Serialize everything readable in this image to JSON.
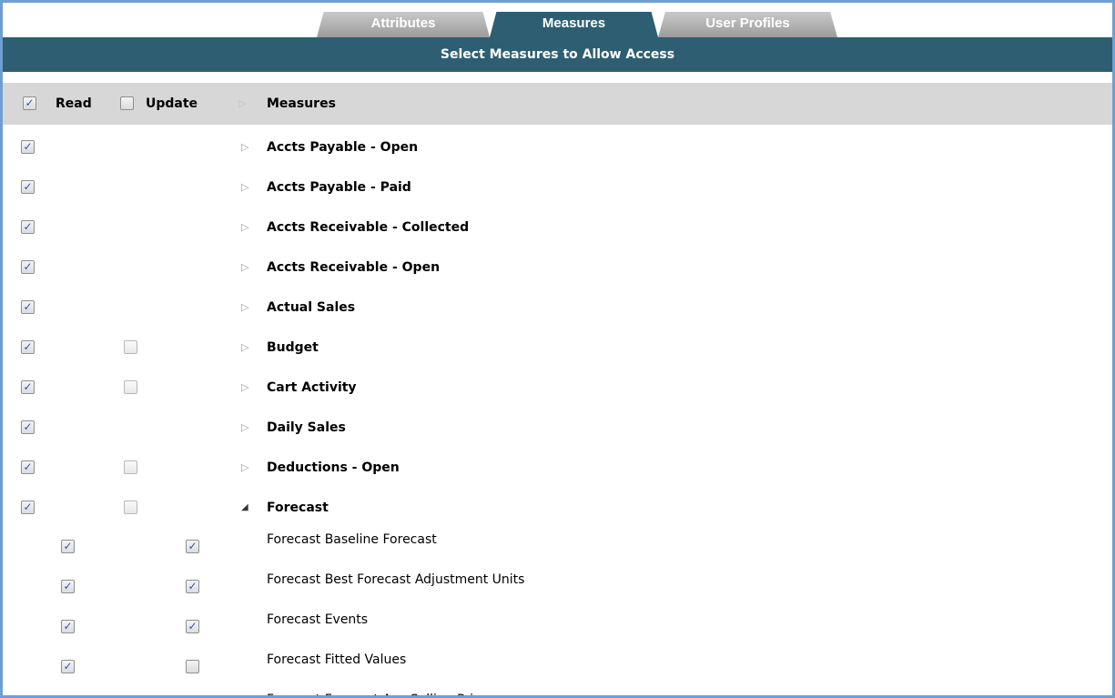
{
  "tabs": [
    {
      "label": "Attributes",
      "active": false
    },
    {
      "label": "Measures",
      "active": true
    },
    {
      "label": "User Profiles",
      "active": false
    }
  ],
  "title": "Select Measures to Allow Access",
  "header": {
    "read_label": "Read",
    "update_label": "Update",
    "measures_label": "Measures",
    "read_all_checked": true,
    "update_all_checked": false
  },
  "measures": [
    {
      "label": "Accts Payable - Open",
      "read": true,
      "update": null,
      "expanded": false
    },
    {
      "label": "Accts Payable - Paid",
      "read": true,
      "update": null,
      "expanded": false
    },
    {
      "label": "Accts Receivable - Collected",
      "read": true,
      "update": null,
      "expanded": false
    },
    {
      "label": "Accts Receivable - Open",
      "read": true,
      "update": null,
      "expanded": false
    },
    {
      "label": "Actual Sales",
      "read": true,
      "update": null,
      "expanded": false
    },
    {
      "label": "Budget",
      "read": true,
      "update": false,
      "expanded": false
    },
    {
      "label": "Cart Activity",
      "read": true,
      "update": false,
      "expanded": false
    },
    {
      "label": "Daily Sales",
      "read": true,
      "update": null,
      "expanded": false
    },
    {
      "label": "Deductions - Open",
      "read": true,
      "update": false,
      "expanded": false
    },
    {
      "label": "Forecast",
      "read": true,
      "update": false,
      "expanded": true
    }
  ],
  "forecast_children": [
    {
      "label": "Forecast Baseline Forecast",
      "read": true,
      "update": true
    },
    {
      "label": "Forecast Best Forecast Adjustment Units",
      "read": true,
      "update": true
    },
    {
      "label": "Forecast Events",
      "read": true,
      "update": true
    },
    {
      "label": "Forecast Fitted Values",
      "read": true,
      "update": false
    },
    {
      "label": "Forecast Forecast Avg Selling Price",
      "read": true,
      "update": false
    }
  ],
  "icons": {
    "collapsed": "triangle-right-icon",
    "expanded": "triangle-down-icon"
  },
  "colors": {
    "header_bar": "#2e5e72",
    "frame_border": "#6e9ed2",
    "checkmark": "#2d55b8"
  }
}
